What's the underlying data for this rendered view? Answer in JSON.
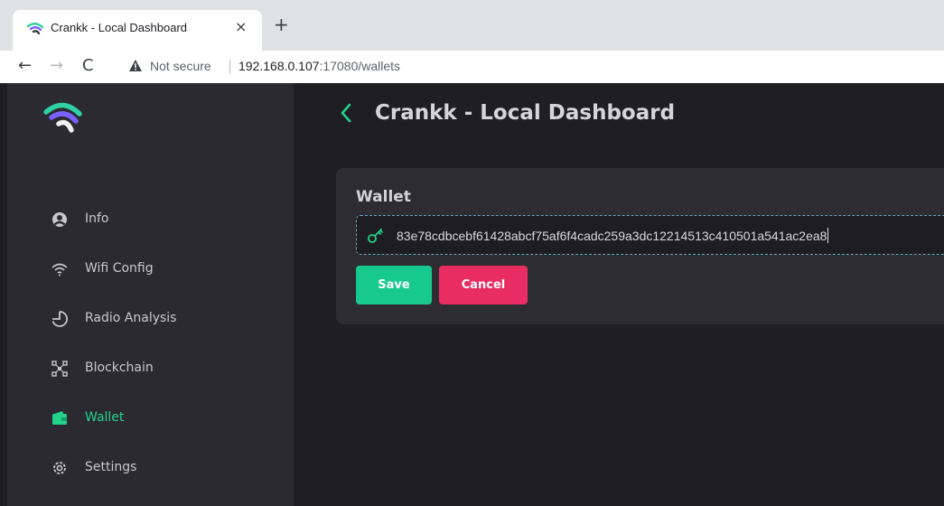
{
  "browser": {
    "tab_title": "Crankk - Local Dashboard",
    "tab_close_glyph": "×",
    "new_tab_glyph": "+",
    "back_glyph": "←",
    "forward_glyph": "→",
    "reload_glyph": "C",
    "security_label": "Not secure",
    "url_separator": "|",
    "url_host": "192.168.0.107",
    "url_path": ":17080/wallets"
  },
  "sidebar": {
    "logo_icon": "crankk-logo-icon",
    "items": [
      {
        "label": "Info",
        "icon": "person-icon"
      },
      {
        "label": "Wifi Config",
        "icon": "wifi-icon"
      },
      {
        "label": "Radio Analysis",
        "icon": "radio-analysis-icon"
      },
      {
        "label": "Blockchain",
        "icon": "blockchain-icon"
      },
      {
        "label": "Wallet",
        "icon": "wallet-icon",
        "active": true
      },
      {
        "label": "Settings",
        "icon": "gear-icon"
      }
    ]
  },
  "header": {
    "back_icon": "chevron-left-icon",
    "title": "Crankk - Local Dashboard"
  },
  "wallet_card": {
    "title": "Wallet",
    "input_icon": "key-icon",
    "wallet_address": "83e78cdbcebf61428abcf75af6f4cadc259a3dc12214513c410501a541ac2ea8",
    "save_label": "Save",
    "cancel_label": "Cancel"
  },
  "colors": {
    "accent_green": "#23d18b",
    "save_button": "#18c98e",
    "cancel_button": "#e92d63",
    "sidebar_bg": "#2a2a30",
    "main_bg": "#1f1f23",
    "card_bg": "#2c2c31"
  }
}
